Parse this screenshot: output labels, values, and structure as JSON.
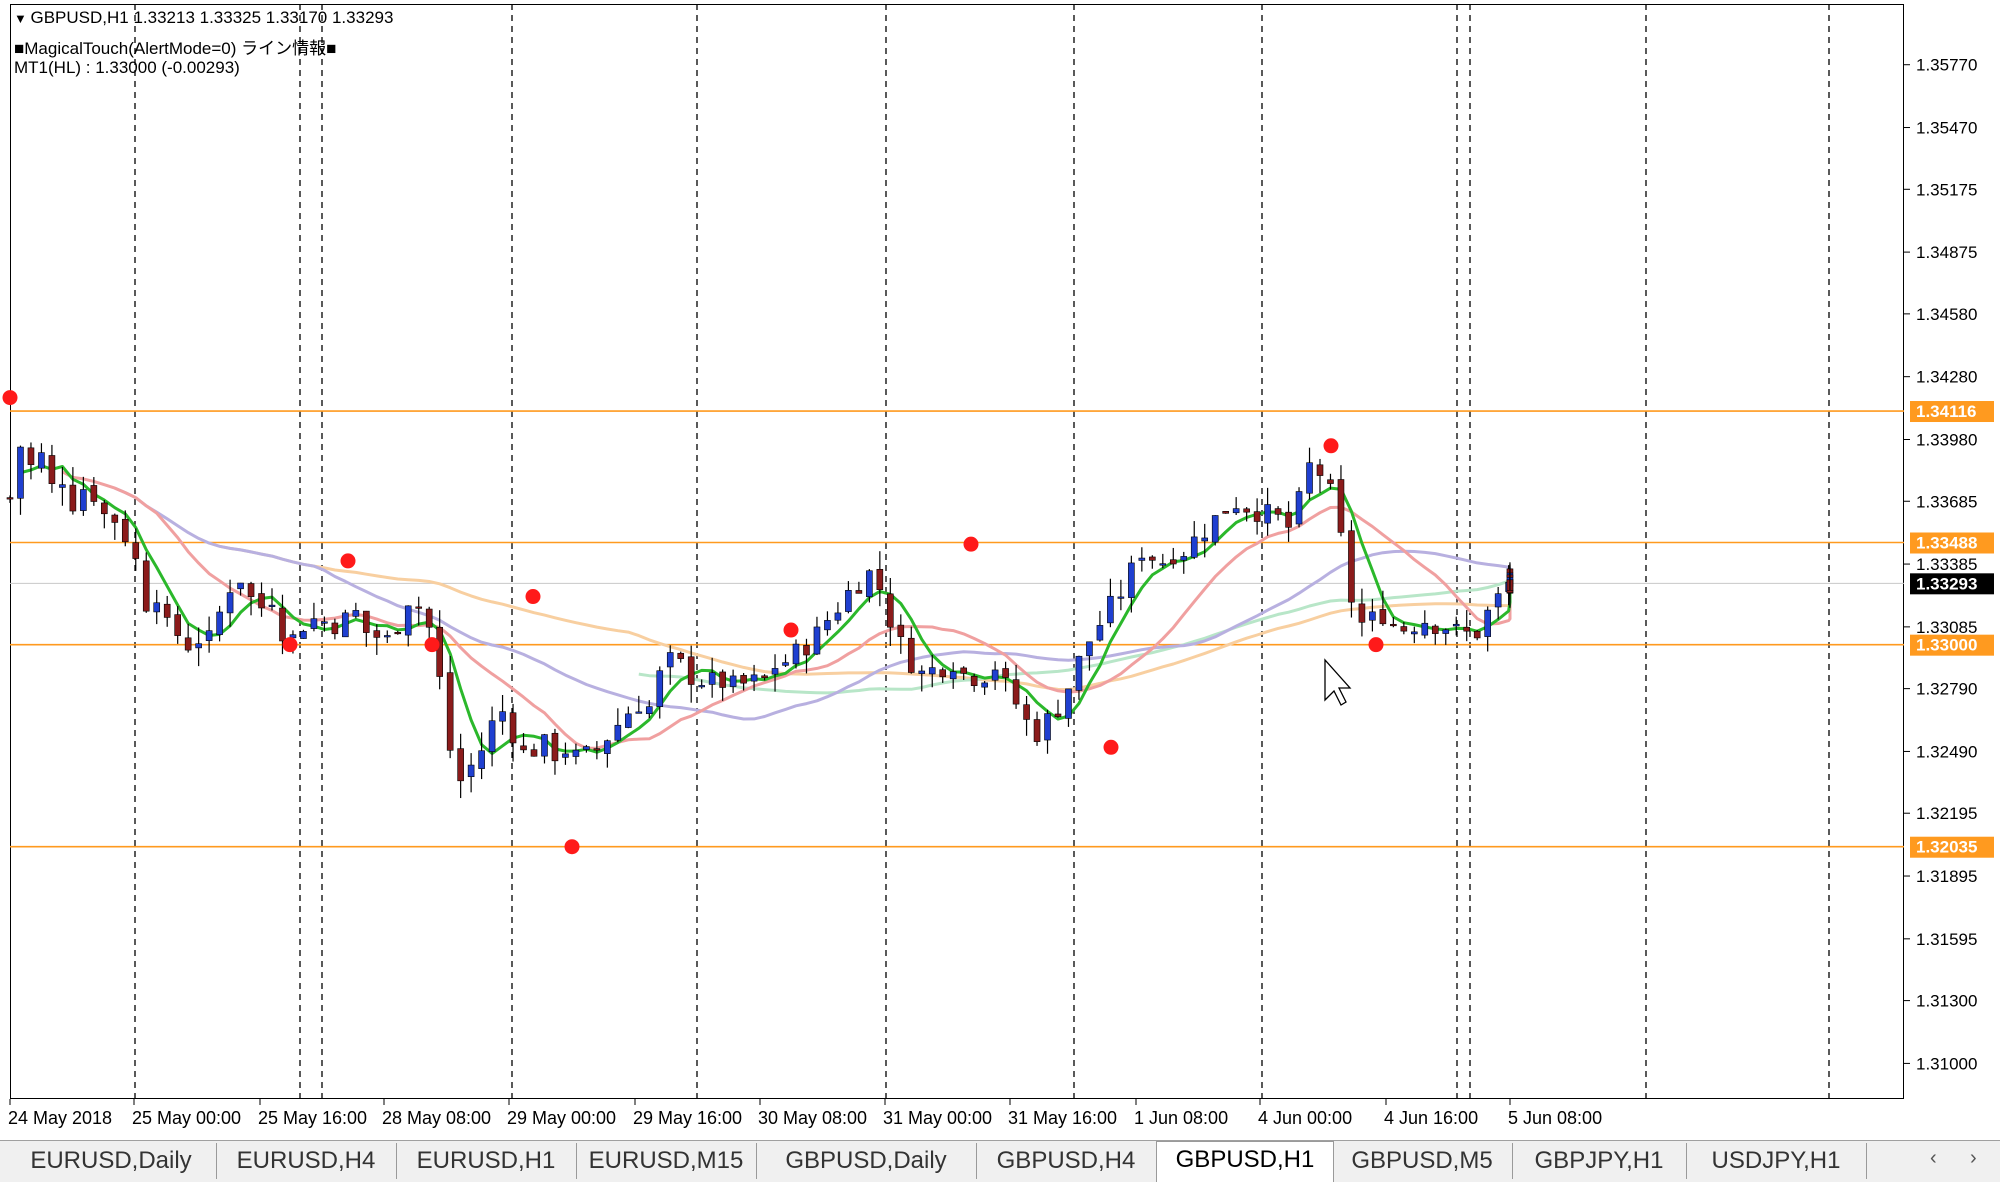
{
  "header": {
    "symbol_line": "GBPUSD,H1  1.33213 1.33325 1.33170 1.33293",
    "indicator_line": "■MagicalTouch(AlertMode=0) ライン情報■",
    "mt1_line": "MT1(HL) : 1.33000 (-0.00293)"
  },
  "colors": {
    "bull": "#1f3fd0",
    "bear": "#8b1b1b",
    "support_line": "#ff9a1f",
    "current_price_bg": "#000000",
    "ma_fast": "#2bb82b",
    "ma_mid": "#f0a0a0",
    "ma_slow": "#f8cfa0",
    "ma_lavender": "#b8b0e0",
    "ma_mint": "#b8e6c8",
    "swing_dot": "#ff1a1a"
  },
  "chart_data": {
    "type": "candlestick",
    "symbol": "GBPUSD",
    "timeframe": "H1",
    "ylim": [
      1.3083,
      1.3606
    ],
    "y_ticks": [
      "1.35770",
      "1.35470",
      "1.35175",
      "1.34875",
      "1.34580",
      "1.34280",
      "1.33980",
      "1.33685",
      "1.33385",
      "1.33085",
      "1.32790",
      "1.32490",
      "1.32195",
      "1.31895",
      "1.31595",
      "1.31300",
      "1.31000"
    ],
    "x_ticks": [
      "24 May 2018",
      "25 May 00:00",
      "25 May 16:00",
      "28 May 08:00",
      "29 May 00:00",
      "29 May 16:00",
      "30 May 08:00",
      "31 May 00:00",
      "31 May 16:00",
      "1 Jun 08:00",
      "4 Jun 00:00",
      "4 Jun 16:00",
      "5 Jun 08:00"
    ],
    "support_levels": [
      "1.34116",
      "1.33488",
      "1.33000",
      "1.32035"
    ],
    "current_price": "1.33293",
    "close_path": [
      [
        0,
        1.337
      ],
      [
        8,
        1.3395
      ],
      [
        16,
        1.3385
      ],
      [
        24,
        1.339
      ],
      [
        32,
        1.3375
      ],
      [
        40,
        1.338
      ],
      [
        48,
        1.3368
      ],
      [
        56,
        1.3375
      ],
      [
        64,
        1.3372
      ],
      [
        72,
        1.3362
      ],
      [
        80,
        1.336
      ],
      [
        88,
        1.3352
      ],
      [
        96,
        1.334
      ],
      [
        104,
        1.332
      ],
      [
        112,
        1.3325
      ],
      [
        120,
        1.3308
      ],
      [
        128,
        1.3305
      ],
      [
        136,
        1.33
      ],
      [
        144,
        1.3303
      ],
      [
        152,
        1.3302
      ],
      [
        160,
        1.3315
      ],
      [
        168,
        1.3328
      ],
      [
        176,
        1.3332
      ],
      [
        184,
        1.3322
      ],
      [
        192,
        1.3318
      ],
      [
        200,
        1.3323
      ],
      [
        208,
        1.3307
      ],
      [
        216,
        1.3303
      ],
      [
        224,
        1.331
      ],
      [
        232,
        1.3312
      ],
      [
        240,
        1.3311
      ],
      [
        248,
        1.331
      ],
      [
        256,
        1.3312
      ],
      [
        264,
        1.3315
      ],
      [
        272,
        1.3306
      ],
      [
        280,
        1.3304
      ],
      [
        288,
        1.3302
      ],
      [
        296,
        1.331
      ],
      [
        304,
        1.3322
      ],
      [
        312,
        1.3318
      ],
      [
        320,
        1.3308
      ],
      [
        328,
        1.3283
      ],
      [
        336,
        1.325
      ],
      [
        344,
        1.3235
      ],
      [
        352,
        1.3242
      ],
      [
        360,
        1.325
      ],
      [
        368,
        1.3262
      ],
      [
        376,
        1.3268
      ],
      [
        384,
        1.3258
      ],
      [
        392,
        1.3248
      ],
      [
        400,
        1.325
      ],
      [
        408,
        1.3252
      ],
      [
        416,
        1.3248
      ],
      [
        424,
        1.325
      ],
      [
        432,
        1.3246
      ],
      [
        440,
        1.3247
      ],
      [
        448,
        1.325
      ],
      [
        456,
        1.3256
      ],
      [
        464,
        1.3262
      ],
      [
        472,
        1.3268
      ],
      [
        480,
        1.3272
      ],
      [
        488,
        1.327
      ],
      [
        496,
        1.3285
      ],
      [
        504,
        1.3292
      ],
      [
        512,
        1.329
      ],
      [
        520,
        1.3285
      ],
      [
        528,
        1.3283
      ],
      [
        536,
        1.3282
      ],
      [
        544,
        1.3282
      ],
      [
        552,
        1.328
      ],
      [
        560,
        1.3281
      ],
      [
        568,
        1.3282
      ],
      [
        576,
        1.3283
      ],
      [
        584,
        1.329
      ],
      [
        592,
        1.3292
      ],
      [
        600,
        1.3296
      ],
      [
        608,
        1.33
      ],
      [
        616,
        1.3305
      ],
      [
        624,
        1.3312
      ],
      [
        632,
        1.3318
      ],
      [
        640,
        1.3325
      ],
      [
        648,
        1.333
      ],
      [
        656,
        1.3334
      ],
      [
        664,
        1.3327
      ],
      [
        672,
        1.3312
      ],
      [
        680,
        1.33
      ],
      [
        688,
        1.3292
      ],
      [
        696,
        1.3286
      ],
      [
        704,
        1.3288
      ],
      [
        712,
        1.329
      ],
      [
        720,
        1.3292
      ],
      [
        728,
        1.3286
      ],
      [
        736,
        1.3285
      ],
      [
        744,
        1.3286
      ],
      [
        752,
        1.329
      ],
      [
        760,
        1.328
      ],
      [
        768,
        1.3272
      ],
      [
        776,
        1.3263
      ],
      [
        784,
        1.3258
      ],
      [
        792,
        1.3264
      ],
      [
        800,
        1.327
      ],
      [
        808,
        1.328
      ],
      [
        816,
        1.3292
      ],
      [
        824,
        1.3302
      ],
      [
        832,
        1.331
      ],
      [
        840,
        1.3318
      ],
      [
        848,
        1.3325
      ],
      [
        856,
        1.3335
      ],
      [
        864,
        1.3345
      ],
      [
        872,
        1.3342
      ],
      [
        880,
        1.334
      ],
      [
        888,
        1.3344
      ],
      [
        896,
        1.3345
      ],
      [
        904,
        1.335
      ],
      [
        912,
        1.3355
      ],
      [
        920,
        1.336
      ],
      [
        928,
        1.3365
      ],
      [
        936,
        1.3368
      ],
      [
        944,
        1.3366
      ],
      [
        952,
        1.3364
      ],
      [
        960,
        1.3362
      ],
      [
        968,
        1.336
      ],
      [
        976,
        1.3356
      ],
      [
        984,
        1.3368
      ],
      [
        992,
        1.3385
      ],
      [
        1000,
        1.3382
      ],
      [
        1008,
        1.3372
      ],
      [
        1016,
        1.335
      ],
      [
        1024,
        1.3322
      ],
      [
        1032,
        1.331
      ],
      [
        1040,
        1.3312
      ],
      [
        1048,
        1.3315
      ],
      [
        1056,
        1.331
      ],
      [
        1064,
        1.3308
      ],
      [
        1072,
        1.331
      ],
      [
        1080,
        1.3312
      ],
      [
        1088,
        1.331
      ],
      [
        1096,
        1.3309
      ],
      [
        1104,
        1.3306
      ],
      [
        1112,
        1.3305
      ],
      [
        1120,
        1.3306
      ],
      [
        1128,
        1.3315
      ],
      [
        1136,
        1.3322
      ],
      [
        1144,
        1.3329
      ]
    ],
    "swing_points_price": [
      1.3418,
      1.33,
      1.334,
      1.33,
      1.3323,
      1.32035,
      1.3307,
      1.3348,
      1.3251,
      1.3395,
      1.33
    ]
  },
  "tabs": [
    {
      "label": "EURUSD,Daily",
      "active": false
    },
    {
      "label": "EURUSD,H4",
      "active": false
    },
    {
      "label": "EURUSD,H1",
      "active": false
    },
    {
      "label": "EURUSD,M15",
      "active": false
    },
    {
      "label": "GBPUSD,Daily",
      "active": false
    },
    {
      "label": "GBPUSD,H4",
      "active": false
    },
    {
      "label": "GBPUSD,H1",
      "active": true
    },
    {
      "label": "GBPUSD,M5",
      "active": false
    },
    {
      "label": "GBPJPY,H1",
      "active": false
    },
    {
      "label": "USDJPY,H1",
      "active": false
    }
  ],
  "tab_nav": {
    "prev_icon": "‹",
    "next_icon": "›"
  }
}
